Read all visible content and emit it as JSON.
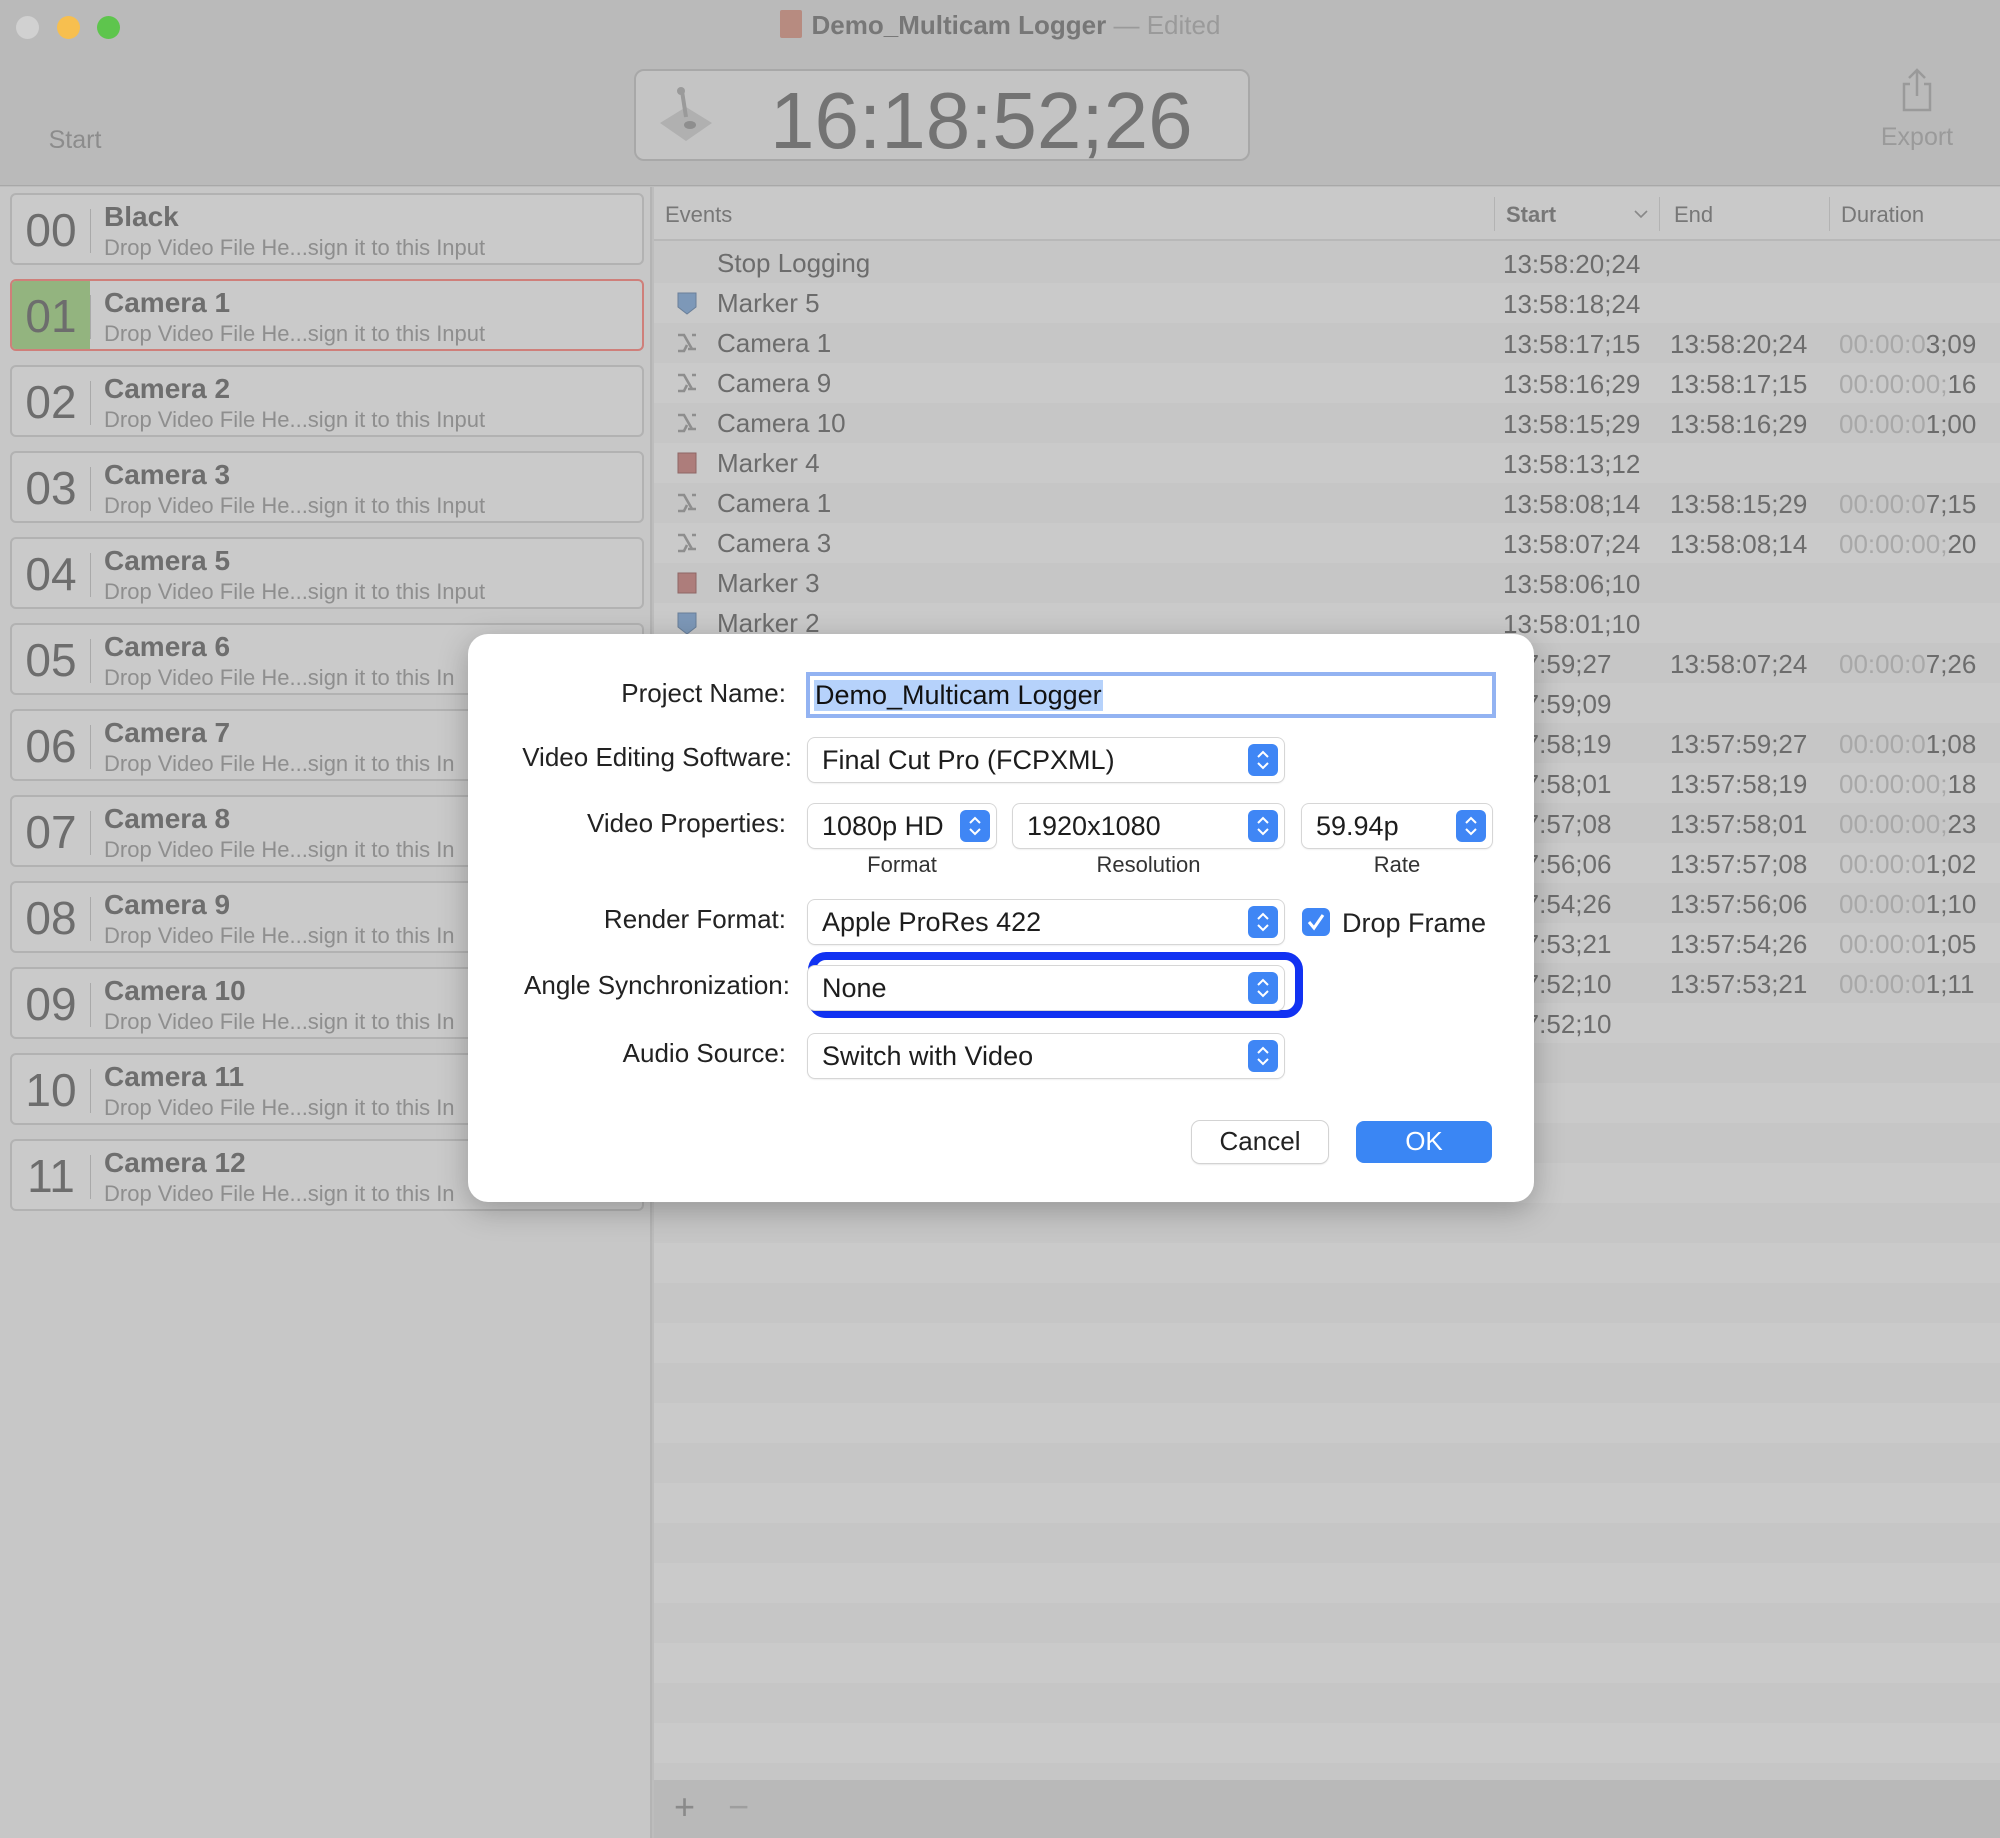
{
  "window": {
    "title": "Demo_Multicam Logger",
    "title_sep": "—",
    "status": "Edited",
    "traffic_colors": [
      "#d1d1d1",
      "#f7bf4f",
      "#5ec54d"
    ]
  },
  "toolbar": {
    "start_label": "Start",
    "timecode": "16:18:52;26",
    "export_label": "Export"
  },
  "inputs": [
    {
      "num": "00",
      "name": "Black",
      "sub": "Drop Video File He...sign it to this Input"
    },
    {
      "num": "01",
      "name": "Camera 1",
      "sub": "Drop Video File He...sign it to this Input",
      "selected": true
    },
    {
      "num": "02",
      "name": "Camera 2",
      "sub": "Drop Video File He...sign it to this Input"
    },
    {
      "num": "03",
      "name": "Camera 3",
      "sub": "Drop Video File He...sign it to this Input"
    },
    {
      "num": "04",
      "name": "Camera 5",
      "sub": "Drop Video File He...sign it to this Input"
    },
    {
      "num": "05",
      "name": "Camera 6",
      "sub": "Drop Video File He...sign it to this In"
    },
    {
      "num": "06",
      "name": "Camera 7",
      "sub": "Drop Video File He...sign it to this In"
    },
    {
      "num": "07",
      "name": "Camera 8",
      "sub": "Drop Video File He...sign it to this In"
    },
    {
      "num": "08",
      "name": "Camera 9",
      "sub": "Drop Video File He...sign it to this In"
    },
    {
      "num": "09",
      "name": "Camera 10",
      "sub": "Drop Video File He...sign it to this In"
    },
    {
      "num": "10",
      "name": "Camera 11",
      "sub": "Drop Video File He...sign it to this In"
    },
    {
      "num": "11",
      "name": "Camera 12",
      "sub": "Drop Video File He...sign it to this In"
    }
  ],
  "events": {
    "columns": {
      "events": "Events",
      "start": "Start",
      "end": "End",
      "duration": "Duration"
    },
    "rows": [
      {
        "icon": "none",
        "name": "Stop Logging",
        "start": "13:58:20;24",
        "end": "",
        "dur_dim": "",
        "dur": ""
      },
      {
        "icon": "marker-blue",
        "name": "Marker 5",
        "start": "13:58:18;24",
        "end": "",
        "dur_dim": "",
        "dur": ""
      },
      {
        "icon": "switch",
        "name": "Camera 1",
        "start": "13:58:17;15",
        "end": "13:58:20;24",
        "dur_dim": "00:00:0",
        "dur": "3;09"
      },
      {
        "icon": "switch",
        "name": "Camera 9",
        "start": "13:58:16;29",
        "end": "13:58:17;15",
        "dur_dim": "00:00:00;",
        "dur": "16"
      },
      {
        "icon": "switch",
        "name": "Camera 10",
        "start": "13:58:15;29",
        "end": "13:58:16;29",
        "dur_dim": "00:00:0",
        "dur": "1;00"
      },
      {
        "icon": "marker-red",
        "name": "Marker 4",
        "start": "13:58:13;12",
        "end": "",
        "dur_dim": "",
        "dur": ""
      },
      {
        "icon": "switch",
        "name": "Camera 1",
        "start": "13:58:08;14",
        "end": "13:58:15;29",
        "dur_dim": "00:00:0",
        "dur": "7;15"
      },
      {
        "icon": "switch",
        "name": "Camera 3",
        "start": "13:58:07;24",
        "end": "13:58:08;14",
        "dur_dim": "00:00:00;",
        "dur": "20"
      },
      {
        "icon": "marker-red",
        "name": "Marker 3",
        "start": "13:58:06;10",
        "end": "",
        "dur_dim": "",
        "dur": ""
      },
      {
        "icon": "marker-blue",
        "name": "Marker 2",
        "start": "13:58:01;10",
        "end": "",
        "dur_dim": "",
        "dur": ""
      },
      {
        "icon": "none",
        "name": "",
        "start": ":57:59;27",
        "end": "13:58:07;24",
        "dur_dim": "00:00:0",
        "dur": "7;26"
      },
      {
        "icon": "none",
        "name": "",
        "start": ":57:59;09",
        "end": "",
        "dur_dim": "",
        "dur": ""
      },
      {
        "icon": "none",
        "name": "",
        "start": ":57:58;19",
        "end": "13:57:59;27",
        "dur_dim": "00:00:0",
        "dur": "1;08"
      },
      {
        "icon": "none",
        "name": "",
        "start": ":57:58;01",
        "end": "13:57:58;19",
        "dur_dim": "00:00:00;",
        "dur": "18"
      },
      {
        "icon": "none",
        "name": "",
        "start": ":57:57;08",
        "end": "13:57:58;01",
        "dur_dim": "00:00:00;",
        "dur": "23"
      },
      {
        "icon": "none",
        "name": "",
        "start": ":57:56;06",
        "end": "13:57:57;08",
        "dur_dim": "00:00:0",
        "dur": "1;02"
      },
      {
        "icon": "none",
        "name": "",
        "start": ":57:54;26",
        "end": "13:57:56;06",
        "dur_dim": "00:00:0",
        "dur": "1;10"
      },
      {
        "icon": "none",
        "name": "",
        "start": ":57:53;21",
        "end": "13:57:54;26",
        "dur_dim": "00:00:0",
        "dur": "1;05"
      },
      {
        "icon": "none",
        "name": "",
        "start": ":57:52;10",
        "end": "13:57:53;21",
        "dur_dim": "00:00:0",
        "dur": "1;11"
      },
      {
        "icon": "none",
        "name": "",
        "start": ":57:52;10",
        "end": "",
        "dur_dim": "",
        "dur": ""
      }
    ],
    "add_label": "+",
    "remove_label": "−"
  },
  "dialog": {
    "project_name_label": "Project Name:",
    "project_name": "Demo_Multicam Logger",
    "software_label": "Video Editing Software:",
    "software": "Final Cut Pro (FCPXML)",
    "video_props_label": "Video Properties:",
    "format": "1080p HD",
    "resolution": "1920x1080",
    "rate": "59.94p",
    "format_caption": "Format",
    "resolution_caption": "Resolution",
    "rate_caption": "Rate",
    "render_label": "Render Format:",
    "render": "Apple ProRes 422",
    "drop_frame_label": "Drop Frame",
    "drop_frame_checked": true,
    "angle_label": "Angle Synchronization:",
    "angle": "None",
    "audio_label": "Audio Source:",
    "audio": "Switch with Video",
    "cancel": "Cancel",
    "ok": "OK",
    "accent": "#3a86f4",
    "highlight": "#1132f2"
  }
}
